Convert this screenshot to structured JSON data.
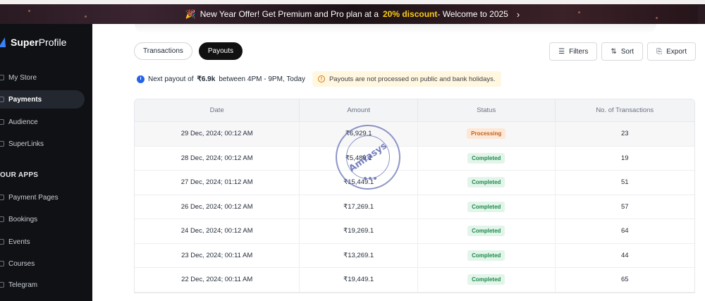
{
  "banner": {
    "text_before": "New Year Offer! Get Premium and Pro plan at a",
    "highlight": "20% discount",
    "text_after": "- Welcome to 2025"
  },
  "sidebar": {
    "logo_bold": "Super",
    "logo_light": "Profile",
    "items": [
      {
        "label": "My Store"
      },
      {
        "label": "Payments"
      },
      {
        "label": "Audience"
      },
      {
        "label": "SuperLinks"
      }
    ],
    "section_label": "OUR APPS",
    "apps": [
      {
        "label": "Payment Pages"
      },
      {
        "label": "Bookings"
      },
      {
        "label": "Events"
      },
      {
        "label": "Courses"
      },
      {
        "label": "Telegram"
      }
    ]
  },
  "tabs": {
    "transactions": "Transactions",
    "payouts": "Payouts"
  },
  "actions": {
    "filters": "Filters",
    "sort": "Sort",
    "export": "Export"
  },
  "payout": {
    "prefix": "Next payout of",
    "amount": "₹6.9k",
    "suffix": "between 4PM - 9PM, Today",
    "notice": "Payouts are not processed on public and bank holidays."
  },
  "table": {
    "headers": {
      "date": "Date",
      "amount": "Amount",
      "status": "Status",
      "count": "No. of Transactions"
    },
    "rows": [
      {
        "date": "29 Dec, 2024; 00:12 AM",
        "amount": "₹6,929.1",
        "status": "Processing",
        "count": "23"
      },
      {
        "date": "28 Dec, 2024; 00:12 AM",
        "amount": "₹5,489.1",
        "status": "Completed",
        "count": "19"
      },
      {
        "date": "27 Dec, 2024; 01:12 AM",
        "amount": "₹15,449.1",
        "status": "Completed",
        "count": "51"
      },
      {
        "date": "26 Dec, 2024; 00:12 AM",
        "amount": "₹17,269.1",
        "status": "Completed",
        "count": "57"
      },
      {
        "date": "24 Dec, 2024; 00:12 AM",
        "amount": "₹19,269.1",
        "status": "Completed",
        "count": "64"
      },
      {
        "date": "23 Dec, 2024; 00:11 AM",
        "amount": "₹13,269.1",
        "status": "Completed",
        "count": "44"
      },
      {
        "date": "22 Dec, 2024; 00:11 AM",
        "amount": "₹19,449.1",
        "status": "Completed",
        "count": "65"
      }
    ]
  },
  "watermark": {
    "text": "Amfasys"
  }
}
